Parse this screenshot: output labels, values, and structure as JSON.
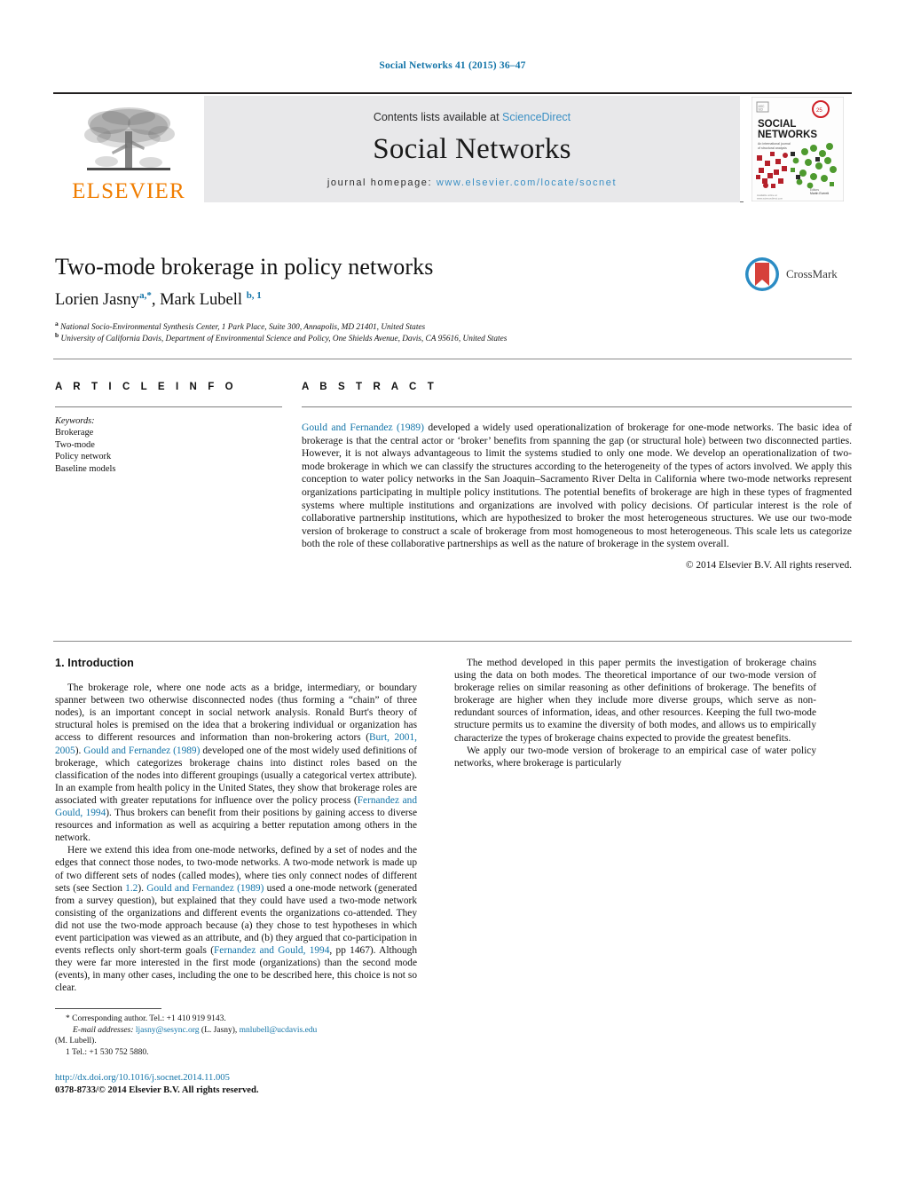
{
  "running_head": "Social Networks 41 (2015) 36–47",
  "masthead": {
    "publisher_name": "ELSEVIER",
    "contents_prefix": "Contents lists available at ",
    "contents_link": "ScienceDirect",
    "journal_name": "Social Networks",
    "homepage_prefix": "journal homepage: ",
    "homepage_url": "www.elsevier.com/locate/socnet",
    "cover_title_line1": "SOCIAL",
    "cover_title_line2": "NETWORKS"
  },
  "article": {
    "title": "Two-mode brokerage in policy networks",
    "authors_html": "Lorien Jasny<sup>a,*</sup>, Mark Lubell <sup>b, 1</sup>",
    "affiliation_a": "National Socio-Environmental Synthesis Center, 1 Park Place, Suite 300, Annapolis, MD 21401, United States",
    "affiliation_b": "University of California Davis, Department of Environmental Science and Policy, One Shields Avenue, Davis, CA 95616, United States",
    "crossmark_label": "CrossMark"
  },
  "info": {
    "heading": "A R T I C L E   I N F O",
    "keywords_label": "Keywords:",
    "keywords": [
      "Brokerage",
      "Two-mode",
      "Policy network",
      "Baseline models"
    ]
  },
  "abstract": {
    "heading": "A B S T R A C T",
    "lead_ref": "Gould and Fernandez (1989)",
    "body": " developed a widely used operationalization of brokerage for one-mode networks. The basic idea of brokerage is that the central actor or ‘broker’ benefits from spanning the gap (or structural hole) between two disconnected parties. However, it is not always advantageous to limit the systems studied to only one mode. We develop an operationalization of two-mode brokerage in which we can classify the structures according to the heterogeneity of the types of actors involved. We apply this conception to water policy networks in the San Joaquin–Sacramento River Delta in California where two-mode networks represent organizations participating in multiple policy institutions. The potential benefits of brokerage are high in these types of fragmented systems where multiple institutions and organizations are involved with policy decisions. Of particular interest is the role of collaborative partnership institutions, which are hypothesized to broker the most heterogeneous structures. We use our two-mode version of brokerage to construct a scale of brokerage from most homogeneous to most heterogeneous. This scale lets us categorize both the role of these collaborative partnerships as well as the nature of brokerage in the system overall.",
    "copyright": "© 2014 Elsevier B.V. All rights reserved."
  },
  "introduction": {
    "heading": "1.  Introduction",
    "p1_a": "The brokerage role, where one node acts as a bridge, intermediary, or boundary spanner between two otherwise disconnected nodes (thus forming a “chain” of three nodes), is an important concept in social network analysis. Ronald Burt's theory of structural holes is premised on the idea that a brokering individual or organization has access to different resources and information than non-brokering actors (",
    "p1_ref1": "Burt, 2001, 2005",
    "p1_b": "). ",
    "p1_ref2": "Gould and Fernandez (1989)",
    "p1_c": " developed one of the most widely used definitions of brokerage, which categorizes brokerage chains into distinct roles based on the classification of the nodes into different groupings (usually a categorical vertex attribute). In an example from health policy in the United States, they show that brokerage roles are associated with greater reputations for influence over the policy process (",
    "p1_ref3": "Fernandez and Gould, 1994",
    "p1_d": "). Thus brokers can benefit from their positions by gaining access to diverse resources and information as well as acquiring a better reputation among others in the network.",
    "p2_a": "Here we extend this idea from one-mode networks, defined by a set of nodes and the edges that connect those nodes, to two-mode networks. A two-mode network is made up of two different sets of nodes (called modes), where ties only connect nodes of different sets (see Section ",
    "p2_ref1": "1.2",
    "p2_b": "). ",
    "p2_ref2": "Gould and Fernandez (1989)",
    "p2_c": " used a one-mode network (generated from a survey question), but explained that they could have used a two-mode network consisting of the organizations and different events the organizations co-attended. They did not use the two-mode approach because (a) they chose to test hypotheses in which event participation was viewed as an attribute, and (b) they argued that co-participation in events reflects only short-term goals (",
    "p2_ref3": "Fernandez and Gould, 1994",
    "p2_d": ", pp 1467). Although they were far more interested in the first mode (organizations) than the second mode (events), in many other cases, including the one to be described here, this choice is not so clear.",
    "p3": "The method developed in this paper permits the investigation of brokerage chains using the data on both modes. The theoretical importance of our two-mode version of brokerage relies on similar reasoning as other definitions of brokerage. The benefits of brokerage are higher when they include more diverse groups, which serve as non-redundant sources of information, ideas, and other resources. Keeping the full two-mode structure permits us to examine the diversity of both modes, and allows us to empirically characterize the types of brokerage chains expected to provide the greatest benefits.",
    "p4": "We apply our two-mode version of brokerage to an empirical case of water policy networks, where brokerage is particularly"
  },
  "footnotes": {
    "corresponding": "* Corresponding author. Tel.: +1 410 919 9143.",
    "email_label": "E-mail addresses:",
    "email_1": "ljasny@sesync.org",
    "email_1_name": " (L. Jasny), ",
    "email_2": "mnlubell@ucdavis.edu",
    "email_2_name": "(M. Lubell).",
    "tel_note": "1  Tel.: +1 530 752 5880.",
    "doi": "http://dx.doi.org/10.1016/j.socnet.2014.11.005",
    "issn_line": "0378-8733/© 2014 Elsevier B.V. All rights reserved."
  },
  "colors": {
    "link": "#1274a8",
    "elsevier_orange": "#f07d00",
    "masthead_grey": "#e8e8ea",
    "crossmark_blue": "#2b8cc4",
    "crossmark_red": "#d6413b"
  }
}
